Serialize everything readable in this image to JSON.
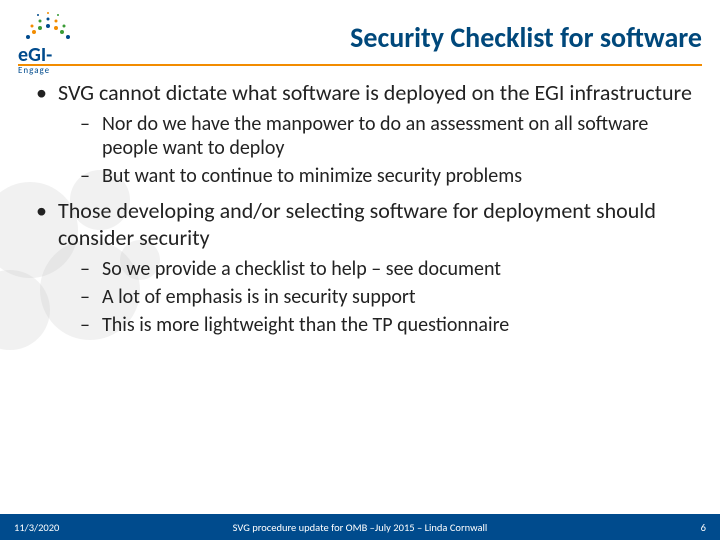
{
  "brand": {
    "name": "eGI",
    "sub": "Engage"
  },
  "title": "Security Checklist for software",
  "bullets": [
    {
      "text": "SVG cannot dictate what software is deployed on the EGI infrastructure",
      "children": [
        "Nor do we have the manpower to do an assessment on all software people want to deploy",
        "But want to continue to minimize security problems"
      ]
    },
    {
      "text": "Those developing and/or selecting software for deployment should consider security",
      "children": [
        "So we provide a checklist to help – see document",
        "A lot of emphasis is in security support",
        "This is more lightweight than the TP questionnaire"
      ]
    }
  ],
  "footer": {
    "date": "11/3/2020",
    "center": "SVG procedure update for OMB –July 2015 – Linda Cornwall",
    "page": "6"
  },
  "colors": {
    "accent_blue": "#004b8d",
    "accent_orange": "#f28c00"
  }
}
